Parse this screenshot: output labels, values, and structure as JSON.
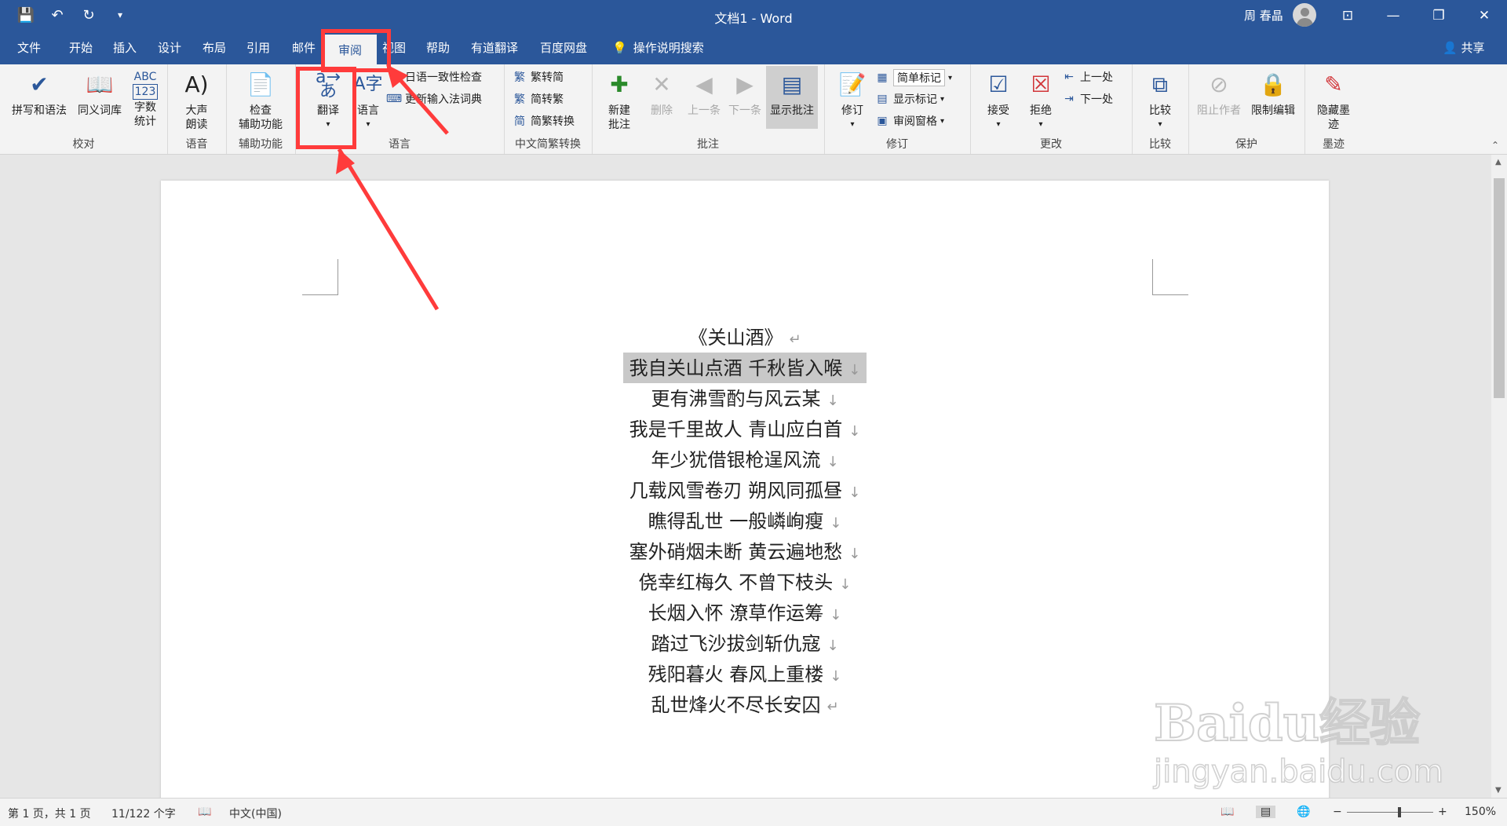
{
  "window": {
    "title": "文档1 - Word",
    "user": "周 春晶",
    "share_label": "共享",
    "tell_me": "操作说明搜索"
  },
  "tabs": [
    "文件",
    "开始",
    "插入",
    "设计",
    "布局",
    "引用",
    "邮件",
    "审阅",
    "视图",
    "帮助",
    "有道翻译",
    "百度网盘"
  ],
  "active_tab": "审阅",
  "ribbon": {
    "proofing": {
      "label": "校对",
      "spell": "拼写和语法",
      "thesaurus": "同义词库",
      "abc": "ABC",
      "count_num": "123",
      "wordcount_1": "字数",
      "wordcount_2": "统计"
    },
    "speech": {
      "label": "语音",
      "read_1": "大声",
      "read_2": "朗读"
    },
    "accessibility": {
      "label": "辅助功能",
      "check_1": "检查",
      "check_2": "辅助功能"
    },
    "language": {
      "label": "语言",
      "translate": "翻译",
      "language": "语言",
      "consistency": "日语一致性检查",
      "update_ime": "更新输入法词典"
    },
    "chinese": {
      "label": "中文简繁转换",
      "t2s": "繁转简",
      "s2t": "简转繁",
      "convert": "简繁转换"
    },
    "comments": {
      "label": "批注",
      "new_1": "新建",
      "new_2": "批注",
      "delete": "删除",
      "prev": "上一条",
      "next": "下一条",
      "show": "显示批注"
    },
    "tracking": {
      "label": "修订",
      "track": "修订",
      "markup": "简单标记",
      "show_markup": "显示标记",
      "pane": "审阅窗格"
    },
    "changes": {
      "label": "更改",
      "accept": "接受",
      "reject": "拒绝",
      "prev": "上一处",
      "next": "下一处"
    },
    "compare": {
      "label": "比较",
      "compare": "比较"
    },
    "protect": {
      "label": "保护",
      "block": "阻止作者",
      "restrict": "限制编辑"
    },
    "ink": {
      "label": "墨迹",
      "hide_1": "隐藏墨",
      "hide_2": "迹"
    }
  },
  "document": {
    "title": "《关山酒》",
    "lines": [
      "我自关山点酒 千秋皆入喉",
      "更有沸雪酌与风云某",
      "我是千里故人 青山应白首",
      "年少犹借银枪逞风流",
      "几载风雪卷刃 朔风同孤昼",
      "瞧得乱世 一般嶙峋瘦",
      "塞外硝烟未断 黄云遍地愁",
      "侥幸红梅久 不曾下枝头",
      "长烟入怀 潦草作运筹",
      "踏过飞沙拔剑斩仇寇",
      "残阳暮火 春风上重楼",
      "乱世烽火不尽长安囚"
    ],
    "paragraph_mark": "↵",
    "line_mark": "↓"
  },
  "status": {
    "page": "第 1 页，共 1 页",
    "words": "11/122 个字",
    "lang": "中文(中国)",
    "zoom": "150%"
  },
  "watermark": {
    "brand": "Baidu经验",
    "url": "jingyan.baidu.com"
  },
  "icons": [
    "save-icon",
    "undo-icon",
    "redo-icon",
    "customize-icon",
    "lightbulb-icon",
    "person-icon",
    "translate-icon",
    "spell-check-icon",
    "book-icon",
    "speaker-icon"
  ],
  "colors": {
    "accent": "#2b579a",
    "annotation": "#ff3b3b",
    "selection": "#c8c8c8"
  }
}
